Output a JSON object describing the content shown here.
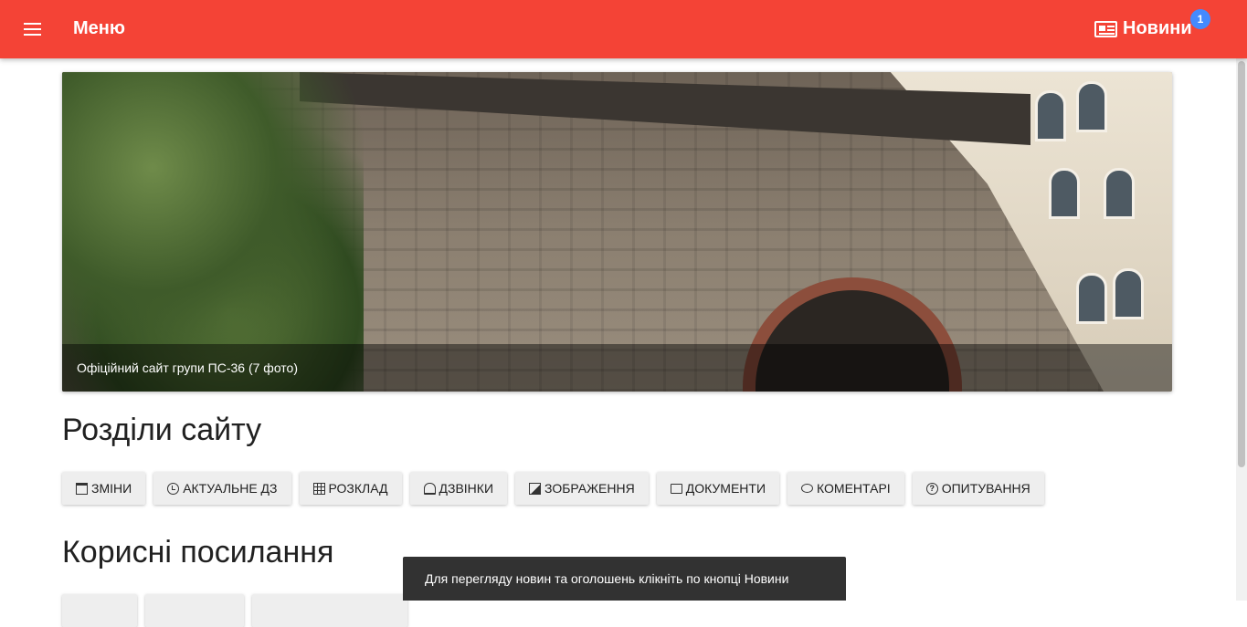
{
  "header": {
    "menu_label": "Меню",
    "news_label": "Новини",
    "news_badge": "1"
  },
  "hero": {
    "caption": "Офіційний сайт групи ПС-36 (7 фото)"
  },
  "sections_title": "Розділи сайту",
  "section_buttons": [
    {
      "label": "Зміни",
      "icon": "calendar-icon"
    },
    {
      "label": "Актуальне ДЗ",
      "icon": "clock-icon"
    },
    {
      "label": "Розклад",
      "icon": "table-icon"
    },
    {
      "label": "Дзвінки",
      "icon": "bell-icon"
    },
    {
      "label": "Зображення",
      "icon": "image-icon"
    },
    {
      "label": "Документи",
      "icon": "folder-open-icon"
    },
    {
      "label": "Коментарі",
      "icon": "comments-icon"
    },
    {
      "label": "Опитування",
      "icon": "question-circle-icon"
    }
  ],
  "links_title": "Корисні посилання",
  "snackbar": {
    "message": "Для перегляду новин та оголошень клікніть по кнопці Новини"
  },
  "colors": {
    "primary": "#f44336",
    "badge": "#448aff",
    "snackbar_bg": "#323232"
  }
}
